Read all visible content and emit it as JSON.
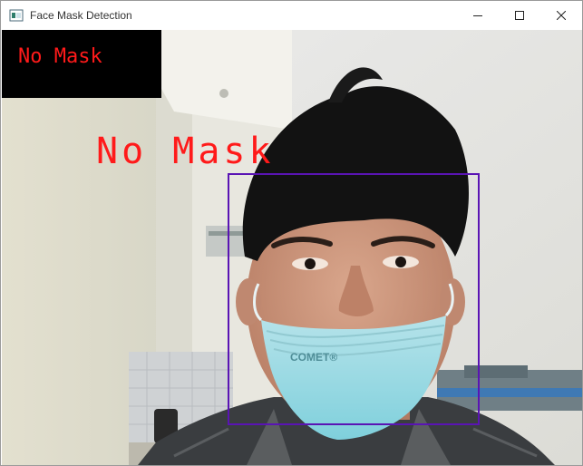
{
  "window": {
    "title": "Face Mask Detection",
    "controls": {
      "minimize_icon": "minimize-icon",
      "maximize_icon": "maximize-icon",
      "close_icon": "close-icon"
    }
  },
  "detection": {
    "status_label": "No Mask",
    "face_label": "No Mask",
    "box_color": "#5a14b4",
    "label_color": "#ff1a1a"
  }
}
